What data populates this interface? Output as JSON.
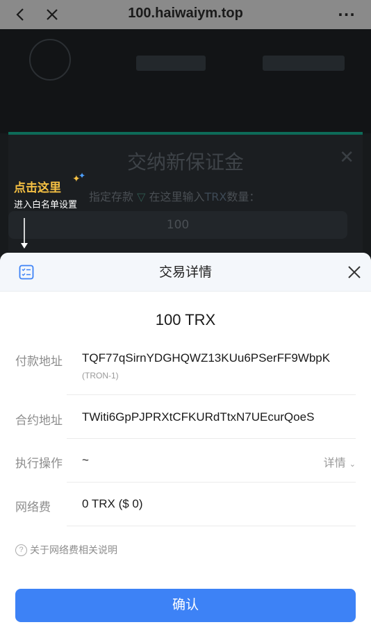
{
  "browser": {
    "url": "100.haiwaiym.top"
  },
  "background": {
    "title": "交纳新保证金",
    "label_prefix": "指定存款",
    "label_mid": "在这里输入",
    "label_trx": "TRX",
    "label_suffix": "数量：",
    "input_value": "100"
  },
  "hint": {
    "title": "点击这里",
    "subtitle": "进入白名单设置"
  },
  "sheet": {
    "title": "交易详情",
    "amount": "100 TRX",
    "rows": [
      {
        "label": "付款地址",
        "value": "TQF77qSirnYDGHQWZ13KUu6PSerFF9WbpK",
        "sub": "(TRON-1)"
      },
      {
        "label": "合约地址",
        "value": "TWiti6GpPJPRXtCFKURdTtxN7UEcurQoeS"
      },
      {
        "label": "执行操作",
        "value": "~",
        "right": "详情"
      },
      {
        "label": "网络费",
        "value": "0 TRX ($ 0)"
      }
    ],
    "fee_note": "关于网络费相关说明",
    "confirm_label": "确认"
  },
  "colors": {
    "accent": "#3d82f6",
    "hint_yellow": "#f5c043",
    "overlay": "#1f1f1f"
  }
}
